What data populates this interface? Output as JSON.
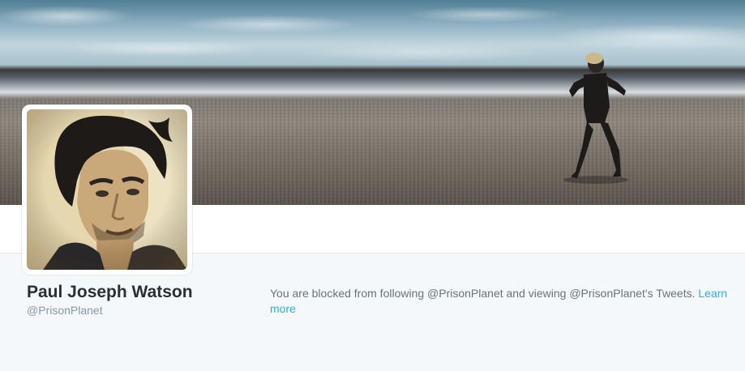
{
  "profile": {
    "name": "Paul Joseph Watson",
    "handle": "@PrisonPlanet"
  },
  "blocked_notice": {
    "message": "You are blocked from following @PrisonPlanet and viewing @PrisonPlanet's Tweets.",
    "link_label": "Learn more"
  },
  "colors": {
    "link": "#2fb1d6",
    "name_text": "#292f33",
    "muted_text": "#8899a6",
    "panel_background": "#f5f8fa"
  }
}
